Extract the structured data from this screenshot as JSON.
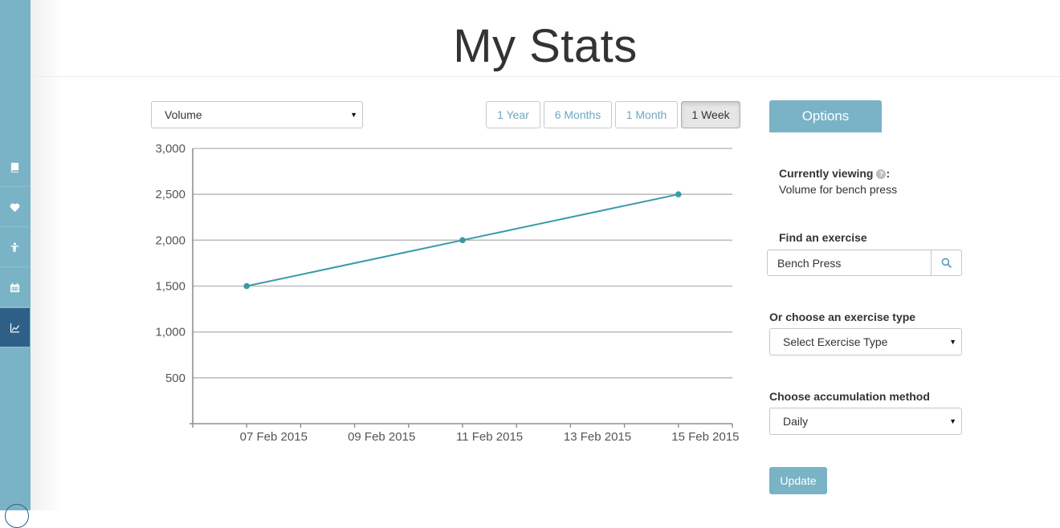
{
  "page": {
    "title": "My Stats"
  },
  "sidebar": {
    "items": [
      {
        "icon": "book-icon"
      },
      {
        "icon": "heart-icon"
      },
      {
        "icon": "figure-icon"
      },
      {
        "icon": "calendar-icon"
      },
      {
        "icon": "line-chart-icon",
        "active": true
      }
    ]
  },
  "controls": {
    "metric_select": "Volume",
    "ranges": [
      "1 Year",
      "6 Months",
      "1 Month",
      "1 Week"
    ],
    "active_range": "1 Week"
  },
  "chart_data": {
    "type": "line",
    "x": [
      "2015-02-06",
      "2015-02-10",
      "2015-02-14"
    ],
    "values": [
      1500,
      2000,
      2500
    ],
    "x_ticks": [
      "07 Feb 2015",
      "09 Feb 2015",
      "11 Feb 2015",
      "13 Feb 2015",
      "15 Feb 2015"
    ],
    "y_ticks": [
      "500",
      "1,000",
      "1,500",
      "2,000",
      "2,500",
      "3,000"
    ],
    "ylim": [
      0,
      3000
    ],
    "grid": true,
    "color": "#3a9ba8"
  },
  "options": {
    "tab_label": "Options",
    "currently_viewing_label": "Currently viewing",
    "currently_viewing_colon": ":",
    "help_icon": "?",
    "currently_viewing_value": "Volume for bench press",
    "find_label": "Find an exercise",
    "search_value": "Bench Press",
    "type_label": "Or choose an exercise type",
    "type_select": "Select Exercise Type",
    "accum_label": "Choose accumulation method",
    "accum_select": "Daily",
    "update_label": "Update"
  },
  "colors": {
    "sidebar": "#7ab3c6",
    "sidebar_active": "#2d5f87",
    "accent": "#7ab3c6",
    "line": "#3a9ba8"
  }
}
